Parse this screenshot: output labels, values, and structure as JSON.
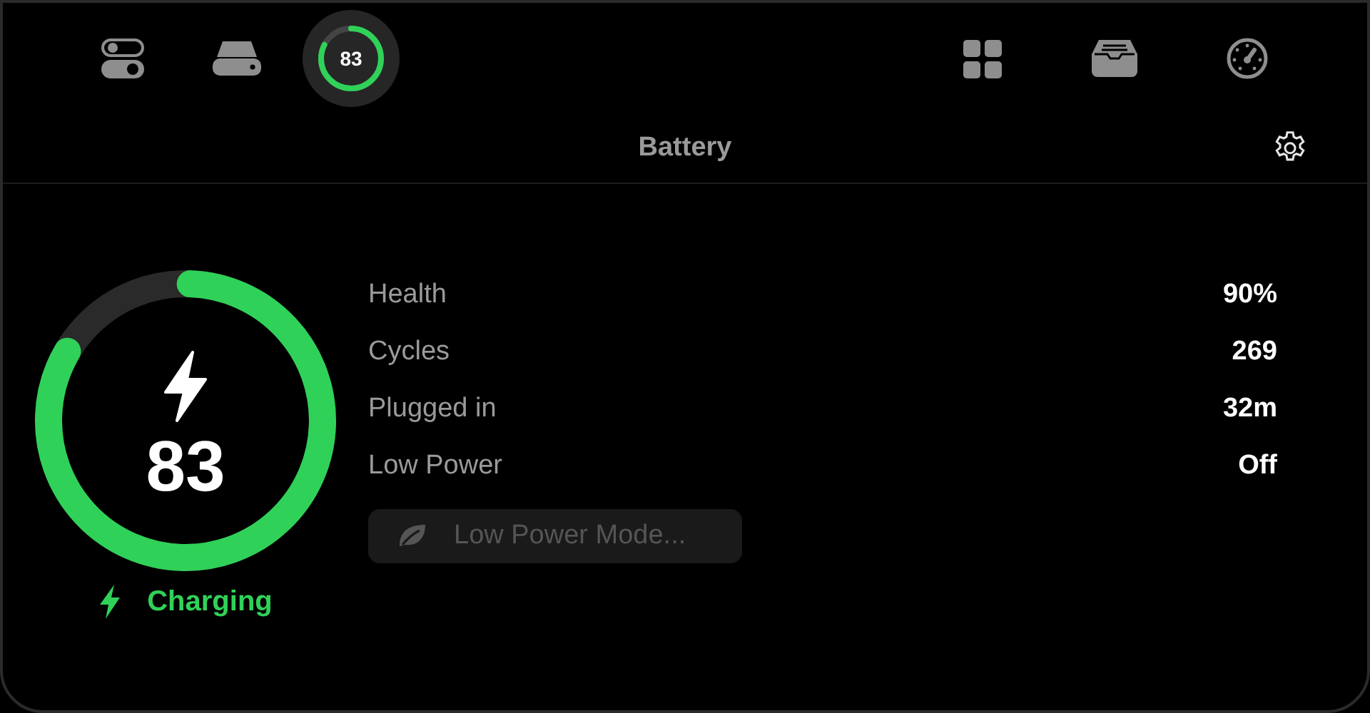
{
  "toolbar": {
    "tabs": [
      {
        "kind": "toggles",
        "selected": false
      },
      {
        "kind": "drive",
        "selected": false
      },
      {
        "kind": "battery",
        "selected": true,
        "label": "83",
        "level": 0.83
      },
      {
        "kind": "grid",
        "selected": false
      },
      {
        "kind": "tray",
        "selected": false
      },
      {
        "kind": "gauge",
        "selected": false
      }
    ]
  },
  "title": "Battery",
  "battery": {
    "percent": "83",
    "level": 0.83,
    "charging": true,
    "status": "Charging"
  },
  "stats": [
    {
      "label": "Health",
      "value": "90%"
    },
    {
      "label": "Cycles",
      "value": "269"
    },
    {
      "label": "Plugged in",
      "value": "32m"
    },
    {
      "label": "Low Power",
      "value": "Off"
    }
  ],
  "low_power_button": {
    "label": "Low Power Mode...",
    "disabled": true
  }
}
